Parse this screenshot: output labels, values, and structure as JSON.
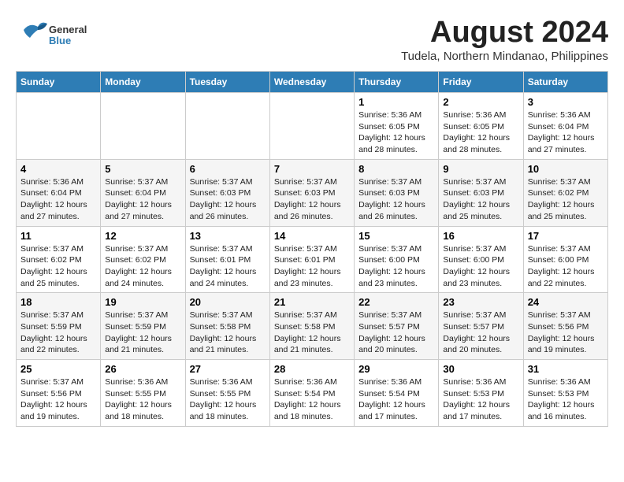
{
  "header": {
    "logo_general": "General",
    "logo_blue": "Blue",
    "month_year": "August 2024",
    "location": "Tudela, Northern Mindanao, Philippines"
  },
  "weekdays": [
    "Sunday",
    "Monday",
    "Tuesday",
    "Wednesday",
    "Thursday",
    "Friday",
    "Saturday"
  ],
  "weeks": [
    [
      {
        "day": "",
        "info": ""
      },
      {
        "day": "",
        "info": ""
      },
      {
        "day": "",
        "info": ""
      },
      {
        "day": "",
        "info": ""
      },
      {
        "day": "1",
        "info": "Sunrise: 5:36 AM\nSunset: 6:05 PM\nDaylight: 12 hours\nand 28 minutes."
      },
      {
        "day": "2",
        "info": "Sunrise: 5:36 AM\nSunset: 6:05 PM\nDaylight: 12 hours\nand 28 minutes."
      },
      {
        "day": "3",
        "info": "Sunrise: 5:36 AM\nSunset: 6:04 PM\nDaylight: 12 hours\nand 27 minutes."
      }
    ],
    [
      {
        "day": "4",
        "info": "Sunrise: 5:36 AM\nSunset: 6:04 PM\nDaylight: 12 hours\nand 27 minutes."
      },
      {
        "day": "5",
        "info": "Sunrise: 5:37 AM\nSunset: 6:04 PM\nDaylight: 12 hours\nand 27 minutes."
      },
      {
        "day": "6",
        "info": "Sunrise: 5:37 AM\nSunset: 6:03 PM\nDaylight: 12 hours\nand 26 minutes."
      },
      {
        "day": "7",
        "info": "Sunrise: 5:37 AM\nSunset: 6:03 PM\nDaylight: 12 hours\nand 26 minutes."
      },
      {
        "day": "8",
        "info": "Sunrise: 5:37 AM\nSunset: 6:03 PM\nDaylight: 12 hours\nand 26 minutes."
      },
      {
        "day": "9",
        "info": "Sunrise: 5:37 AM\nSunset: 6:03 PM\nDaylight: 12 hours\nand 25 minutes."
      },
      {
        "day": "10",
        "info": "Sunrise: 5:37 AM\nSunset: 6:02 PM\nDaylight: 12 hours\nand 25 minutes."
      }
    ],
    [
      {
        "day": "11",
        "info": "Sunrise: 5:37 AM\nSunset: 6:02 PM\nDaylight: 12 hours\nand 25 minutes."
      },
      {
        "day": "12",
        "info": "Sunrise: 5:37 AM\nSunset: 6:02 PM\nDaylight: 12 hours\nand 24 minutes."
      },
      {
        "day": "13",
        "info": "Sunrise: 5:37 AM\nSunset: 6:01 PM\nDaylight: 12 hours\nand 24 minutes."
      },
      {
        "day": "14",
        "info": "Sunrise: 5:37 AM\nSunset: 6:01 PM\nDaylight: 12 hours\nand 23 minutes."
      },
      {
        "day": "15",
        "info": "Sunrise: 5:37 AM\nSunset: 6:00 PM\nDaylight: 12 hours\nand 23 minutes."
      },
      {
        "day": "16",
        "info": "Sunrise: 5:37 AM\nSunset: 6:00 PM\nDaylight: 12 hours\nand 23 minutes."
      },
      {
        "day": "17",
        "info": "Sunrise: 5:37 AM\nSunset: 6:00 PM\nDaylight: 12 hours\nand 22 minutes."
      }
    ],
    [
      {
        "day": "18",
        "info": "Sunrise: 5:37 AM\nSunset: 5:59 PM\nDaylight: 12 hours\nand 22 minutes."
      },
      {
        "day": "19",
        "info": "Sunrise: 5:37 AM\nSunset: 5:59 PM\nDaylight: 12 hours\nand 21 minutes."
      },
      {
        "day": "20",
        "info": "Sunrise: 5:37 AM\nSunset: 5:58 PM\nDaylight: 12 hours\nand 21 minutes."
      },
      {
        "day": "21",
        "info": "Sunrise: 5:37 AM\nSunset: 5:58 PM\nDaylight: 12 hours\nand 21 minutes."
      },
      {
        "day": "22",
        "info": "Sunrise: 5:37 AM\nSunset: 5:57 PM\nDaylight: 12 hours\nand 20 minutes."
      },
      {
        "day": "23",
        "info": "Sunrise: 5:37 AM\nSunset: 5:57 PM\nDaylight: 12 hours\nand 20 minutes."
      },
      {
        "day": "24",
        "info": "Sunrise: 5:37 AM\nSunset: 5:56 PM\nDaylight: 12 hours\nand 19 minutes."
      }
    ],
    [
      {
        "day": "25",
        "info": "Sunrise: 5:37 AM\nSunset: 5:56 PM\nDaylight: 12 hours\nand 19 minutes."
      },
      {
        "day": "26",
        "info": "Sunrise: 5:36 AM\nSunset: 5:55 PM\nDaylight: 12 hours\nand 18 minutes."
      },
      {
        "day": "27",
        "info": "Sunrise: 5:36 AM\nSunset: 5:55 PM\nDaylight: 12 hours\nand 18 minutes."
      },
      {
        "day": "28",
        "info": "Sunrise: 5:36 AM\nSunset: 5:54 PM\nDaylight: 12 hours\nand 18 minutes."
      },
      {
        "day": "29",
        "info": "Sunrise: 5:36 AM\nSunset: 5:54 PM\nDaylight: 12 hours\nand 17 minutes."
      },
      {
        "day": "30",
        "info": "Sunrise: 5:36 AM\nSunset: 5:53 PM\nDaylight: 12 hours\nand 17 minutes."
      },
      {
        "day": "31",
        "info": "Sunrise: 5:36 AM\nSunset: 5:53 PM\nDaylight: 12 hours\nand 16 minutes."
      }
    ]
  ]
}
